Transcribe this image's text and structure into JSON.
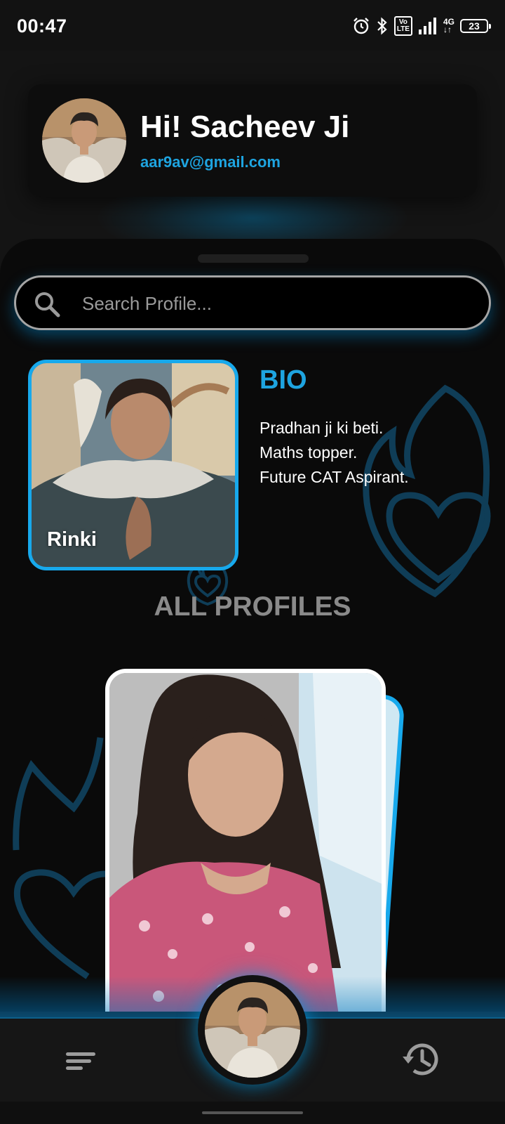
{
  "status_bar": {
    "time": "00:47",
    "icons": [
      "alarm-icon",
      "bluetooth-icon",
      "volte-icon",
      "signal-icon",
      "4g-icon",
      "battery-icon"
    ],
    "volte_label": "Vo LTE",
    "network": "4G",
    "battery": "23"
  },
  "header": {
    "greeting": "Hi! Sacheev Ji",
    "email": "aar9av@gmail.com"
  },
  "search": {
    "placeholder": "Search Profile..."
  },
  "featured": {
    "name": "Rinki",
    "bio_title": "BIO",
    "bio_lines": [
      "Pradhan ji ki beti.",
      "Maths topper.",
      "Future CAT Aspirant."
    ]
  },
  "all_profiles": {
    "title": "ALL PROFILES"
  },
  "nav": {
    "left_icon": "menu-icon",
    "center_icon": "profile-avatar",
    "right_icon": "history-icon"
  },
  "colors": {
    "accent": "#1ea4e0",
    "card_border": "#17a9ec",
    "background": "#0a0a0a",
    "heading_gray": "#8a8a8a"
  }
}
